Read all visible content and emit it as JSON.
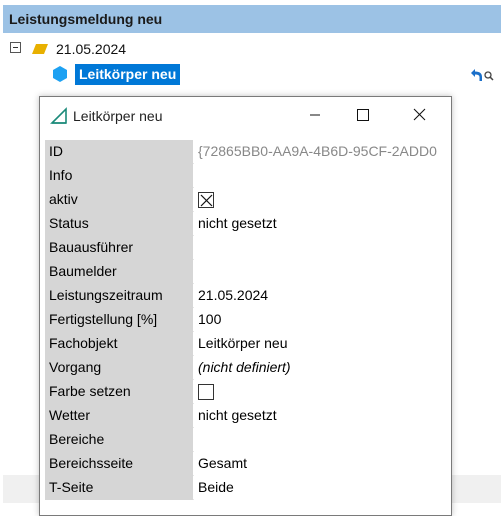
{
  "header": {
    "title": "Leistungsmeldung neu"
  },
  "tree": {
    "date_node": "21.05.2024",
    "selected_node": "Leitkörper neu"
  },
  "dialog": {
    "title": "Leitkörper neu",
    "rows": [
      {
        "label": "ID",
        "value": "{72865BB0-AA9A-4B6D-95CF-2ADD0"
      },
      {
        "label": "Info",
        "value": ""
      },
      {
        "label": "aktiv",
        "checked": true
      },
      {
        "label": "Status",
        "value": "nicht gesetzt"
      },
      {
        "label": "Bauausführer",
        "value": ""
      },
      {
        "label": "Baumelder",
        "value": ""
      },
      {
        "label": "Leistungszeitraum",
        "value": "21.05.2024"
      },
      {
        "label": "Fertigstellung [%]",
        "value": "100"
      },
      {
        "label": "Fachobjekt",
        "value": "Leitkörper neu"
      },
      {
        "label": "Vorgang",
        "value": "(nicht definiert)"
      },
      {
        "label": "Farbe setzen",
        "checked": false
      },
      {
        "label": "Wetter",
        "value": "nicht gesetzt"
      },
      {
        "label": "Bereiche",
        "value": ""
      },
      {
        "label": "Bereichsseite",
        "value": "Gesamt"
      },
      {
        "label": "T-Seite",
        "value": "Beide"
      }
    ]
  },
  "colors": {
    "header_bg": "#9cc2e5",
    "selection": "#0078d7",
    "label_bg": "#d6d6d6",
    "folder": "#e8b000",
    "hex": "#1da1f2"
  },
  "icons": [
    "collapse-icon",
    "folder-icon",
    "hexagon-icon",
    "undo-icon",
    "search-icon",
    "dialog-app-icon",
    "minimize-icon",
    "maximize-icon",
    "close-icon"
  ]
}
